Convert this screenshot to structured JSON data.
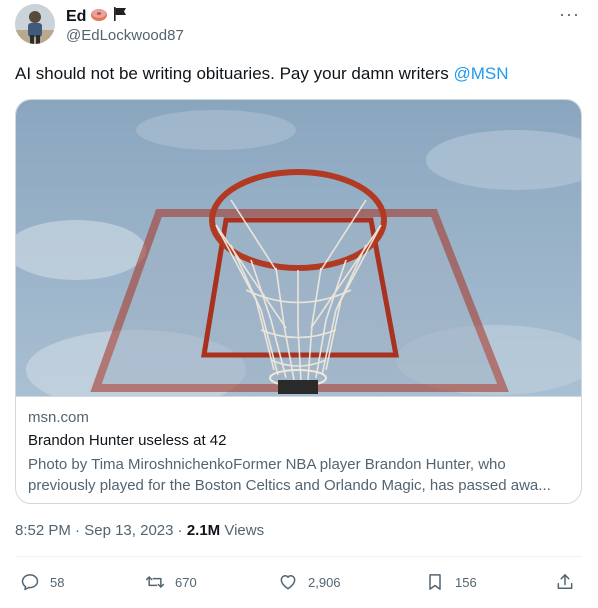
{
  "author": {
    "name": "Ed",
    "handle": "@EdLockwood87",
    "avatar_icon": "person-avatar"
  },
  "header": {
    "more_label": "···",
    "badges": [
      "donut-icon",
      "black-flag-icon"
    ]
  },
  "tweet": {
    "text": "AI should not be writing obituaries. Pay your damn writers ",
    "mention": "@MSN"
  },
  "card": {
    "image_icon": "basketball-hoop-photo",
    "domain": "msn.com",
    "title": "Brandon Hunter useless at 42",
    "description_line1": "Photo by Tima MiroshnichenkoFormer NBA player Brandon Hunter, who",
    "description_line2": "previously played for the Boston Celtics and Orlando Magic, has passed awa..."
  },
  "meta": {
    "time": "8:52 PM",
    "separator": " · ",
    "date": "Sep 13, 2023",
    "views_count": "2.1M",
    "views_label": " Views"
  },
  "actions": {
    "replies": "58",
    "retweets": "670",
    "likes": "2,906",
    "bookmarks": "156"
  },
  "colors": {
    "accent": "#1d9bf0",
    "text_primary": "#0f1419",
    "text_secondary": "#536471",
    "border": "#cfd9de"
  }
}
